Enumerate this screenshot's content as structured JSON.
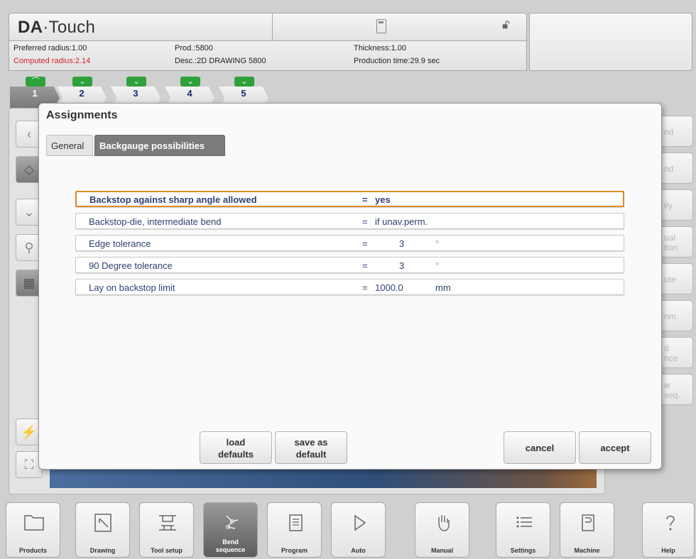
{
  "app": {
    "logo_bold": "DA",
    "logo_rest": "·Touch"
  },
  "header": {
    "preferred_radius": "Preferred radius:1.00",
    "computed_radius": "Computed radius:2.14",
    "prod": "Prod.:5800",
    "desc": "Desc.:2D DRAWING 5800",
    "thickness": "Thickness:1.00",
    "production_time": "Production time:29.9 sec"
  },
  "steps": [
    "1",
    "2",
    "3",
    "4",
    "5"
  ],
  "right_buttons": [
    {
      "l1": "nd",
      "l2": ""
    },
    {
      "l1": "nd",
      "l2": ""
    },
    {
      "l1": "ify",
      "l2": ""
    },
    {
      "l1": "ual",
      "l2": "tion"
    },
    {
      "l1": "ute",
      "l2": ""
    },
    {
      "l1": "nm.",
      "l2": ""
    },
    {
      "l1": "d",
      "l2": "nce"
    },
    {
      "l1": "w",
      "l2": "seq."
    }
  ],
  "dialog": {
    "title": "Assignments",
    "tabs": {
      "general": "General",
      "backgauge": "Backgauge possibilities"
    },
    "rows": [
      {
        "label": "Backstop against sharp angle allowed",
        "eq": "=",
        "value": "yes",
        "unit": ""
      },
      {
        "label": "Backstop-die, intermediate bend",
        "eq": "=",
        "value": "if unav.perm.",
        "unit": ""
      },
      {
        "label": "Edge tolerance",
        "eq": "=",
        "value": "3",
        "unit": "°"
      },
      {
        "label": "90 Degree tolerance",
        "eq": "=",
        "value": "3",
        "unit": "°"
      },
      {
        "label": "Lay on backstop limit",
        "eq": "=",
        "value": "1000.0",
        "unit": "mm"
      }
    ],
    "buttons": {
      "load_l1": "load",
      "load_l2": "defaults",
      "save_l1": "save as",
      "save_l2": "default",
      "cancel": "cancel",
      "accept": "accept"
    }
  },
  "nav": {
    "products": "Products",
    "drawing": "Drawing",
    "tool_setup": "Tool setup",
    "bend_l1": "Bend",
    "bend_l2": "sequence",
    "program": "Program",
    "auto": "Auto",
    "manual": "Manual",
    "settings": "Settings",
    "machine": "Machine",
    "help": "Help"
  },
  "colors": {
    "accent_orange": "#e08a2a",
    "step_green": "#2ea13b",
    "text_blue": "#2e3f73",
    "alert_red": "#d8232a"
  }
}
